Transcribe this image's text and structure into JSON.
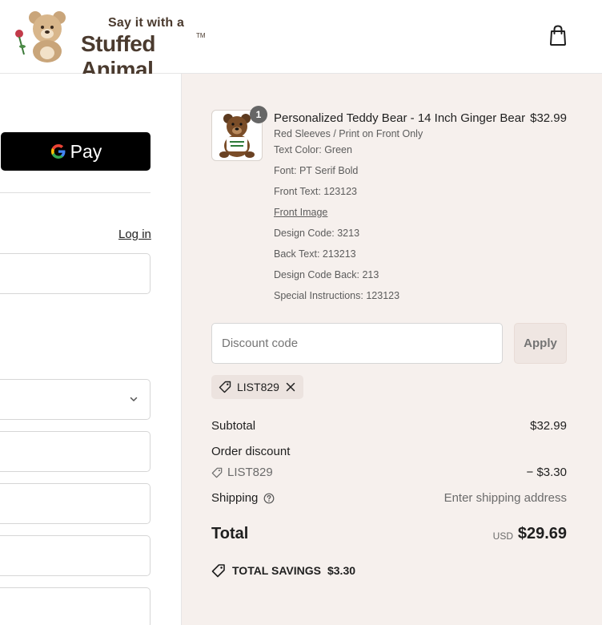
{
  "brand": {
    "tagline": "Say it with a",
    "name": "Stuffed Animal",
    "trademark": "TM"
  },
  "header": {
    "cart_icon": "shopping-bag-icon"
  },
  "express": {
    "gpay_label": "Pay"
  },
  "contact": {
    "login_label": "Log in"
  },
  "order": {
    "quantity": "1",
    "product_name": "Personalized Teddy Bear - 14 Inch Ginger Bear",
    "product_price": "$32.99",
    "properties": [
      "Red Sleeves / Print on Front Only",
      "Text Color: Green",
      "Font: PT Serif Bold",
      "Front Text: 123123",
      "Front Image",
      "Design Code: 3213",
      "Back Text: 213213",
      "Design Code Back: 213",
      "Special Instructions: 123123"
    ]
  },
  "discount": {
    "placeholder": "Discount code",
    "apply_label": "Apply",
    "applied_code": "LIST829"
  },
  "summary": {
    "subtotal_label": "Subtotal",
    "subtotal_value": "$32.99",
    "order_discount_label": "Order discount",
    "discount_code": "LIST829",
    "discount_value": "− $3.30",
    "shipping_label": "Shipping",
    "shipping_value": "Enter shipping address",
    "total_label": "Total",
    "currency": "USD",
    "total_value": "$29.69",
    "savings_label": "TOTAL SAVINGS",
    "savings_value": "$3.30"
  },
  "colors": {
    "summary_bg": "#f6f0ed",
    "gpay_bg": "#000000",
    "brand_brown": "#4a3a2e"
  }
}
